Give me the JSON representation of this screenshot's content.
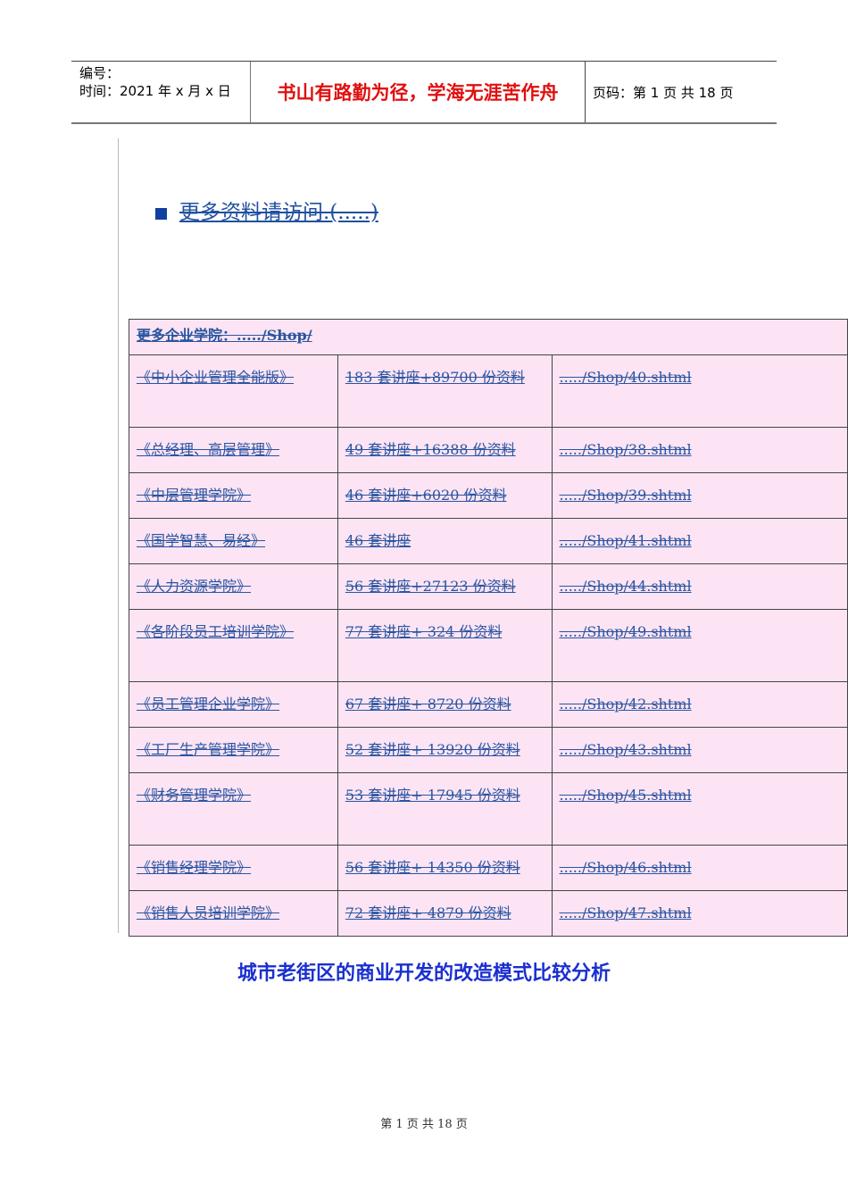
{
  "header": {
    "number_label": "编号：",
    "date_label": "时间：2021 年 x 月 x 日",
    "motto": "书山有路勤为径，学海无涯苦作舟",
    "page_info": "页码：第 1 页  共 18 页"
  },
  "more_link": "更多资料请访问.(.....)",
  "table": {
    "header": "更多企业学院：...../Shop/",
    "rows": [
      {
        "name": "《中小企业管理全能版》",
        "desc": "183 套讲座+89700 份资料",
        "url": "...../Shop/40.shtml"
      },
      {
        "name": "《总经理、高层管理》",
        "desc": "49 套讲座+16388 份资料",
        "url": "...../Shop/38.shtml"
      },
      {
        "name": "《中层管理学院》",
        "desc": "46 套讲座+6020 份资料",
        "url": "...../Shop/39.shtml"
      },
      {
        "name": "《国学智慧、易经》",
        "desc": "46 套讲座",
        "url": "...../Shop/41.shtml"
      },
      {
        "name": "《人力资源学院》",
        "desc": "56 套讲座+27123 份资料",
        "url": "...../Shop/44.shtml"
      },
      {
        "name": "《各阶段员工培训学院》",
        "desc": "77 套讲座+ 324 份资料",
        "url": "...../Shop/49.shtml"
      },
      {
        "name": "《员工管理企业学院》",
        "desc": "67 套讲座+ 8720 份资料",
        "url": "...../Shop/42.shtml"
      },
      {
        "name": "《工厂生产管理学院》",
        "desc": "52 套讲座+ 13920 份资料",
        "url": "...../Shop/43.shtml"
      },
      {
        "name": "《财务管理学院》",
        "desc": "53 套讲座+ 17945 份资料",
        "url": "...../Shop/45.shtml"
      },
      {
        "name": "《销售经理学院》",
        "desc": "56 套讲座+ 14350 份资料",
        "url": "...../Shop/46.shtml"
      },
      {
        "name": "《销售人员培训学院》",
        "desc": "72 套讲座+ 4879 份资料",
        "url": "...../Shop/47.shtml"
      }
    ]
  },
  "title": "城市老街区的商业开发的改造模式比较分析",
  "footer": "第 1 页 共 18 页"
}
